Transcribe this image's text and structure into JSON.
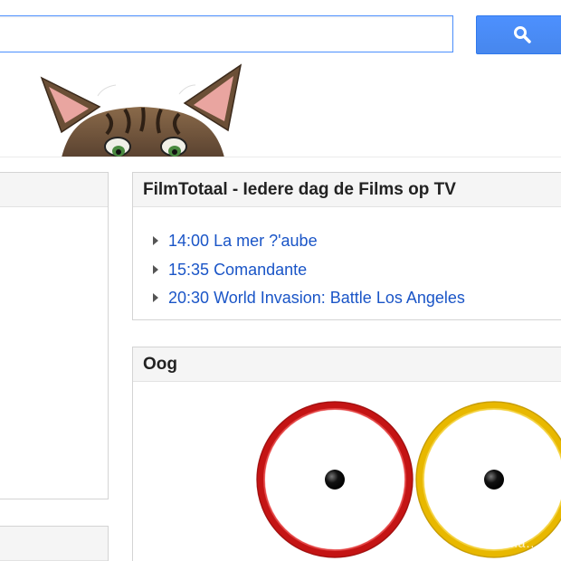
{
  "search": {
    "value": "",
    "placeholder": "",
    "button_icon": "search-icon"
  },
  "header": {
    "artwork": "cat-peeking-artwork"
  },
  "gadgets": {
    "left_top": {
      "title": ""
    },
    "left_bottom": {
      "title": ""
    },
    "film": {
      "title": "FilmTotaal - Iedere dag de Films op TV",
      "items": [
        {
          "time": "14:00",
          "title": "La mer ?'aube"
        },
        {
          "time": "15:35",
          "title": "Comandante"
        },
        {
          "time": "20:30",
          "title": "World Invasion: Battle Los Angeles"
        }
      ],
      "link_color": "#1a55c7"
    },
    "oog": {
      "title": "Oog",
      "eye_colors": [
        "#d21f1f",
        "#f1c40f"
      ]
    }
  },
  "watermark": "ma...",
  "colors": {
    "accent": "#4d90fe",
    "gadget_border": "#d4d4d4",
    "gadget_header_bg": "#f5f5f5"
  }
}
